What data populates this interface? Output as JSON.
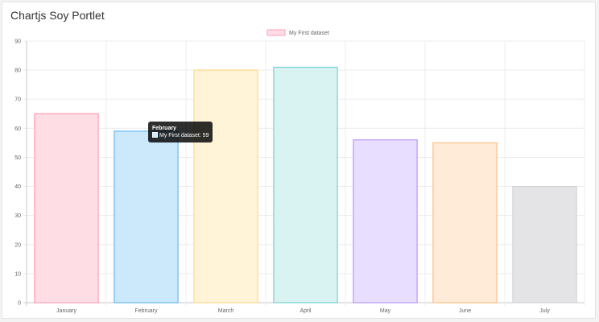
{
  "portlet": {
    "title": "Chartjs Soy Portlet"
  },
  "chart_data": {
    "type": "bar",
    "title": "",
    "xlabel": "",
    "ylabel": "",
    "categories": [
      "January",
      "February",
      "March",
      "April",
      "May",
      "June",
      "July"
    ],
    "series": [
      {
        "name": "My First dataset",
        "values": [
          65,
          59,
          80,
          81,
          56,
          55,
          40
        ],
        "fill_colors": [
          "#ffdde4",
          "#cce9fc",
          "#fff3d8",
          "#d9f2f2",
          "#e8deff",
          "#ffebd7",
          "#e4e4e6"
        ],
        "border_colors": [
          "#ff9fb4",
          "#66b8f0",
          "#ffd98a",
          "#77d2d2",
          "#b797ff",
          "#ffbd80",
          "#d2d3d6"
        ]
      }
    ],
    "ylim": [
      0,
      90
    ],
    "yticks": [
      "0",
      "10",
      "20",
      "30",
      "40",
      "50",
      "60",
      "70",
      "80",
      "90"
    ],
    "grid": true,
    "legend_position": "top",
    "legend": {
      "label": "My First dataset",
      "swatch_fill": "#ffdde4",
      "swatch_border": "#ff9fb4"
    },
    "tooltip": {
      "title": "February",
      "body": "My First dataset: 59",
      "swatch_color": "#cce9fc",
      "category_index": 1
    }
  }
}
